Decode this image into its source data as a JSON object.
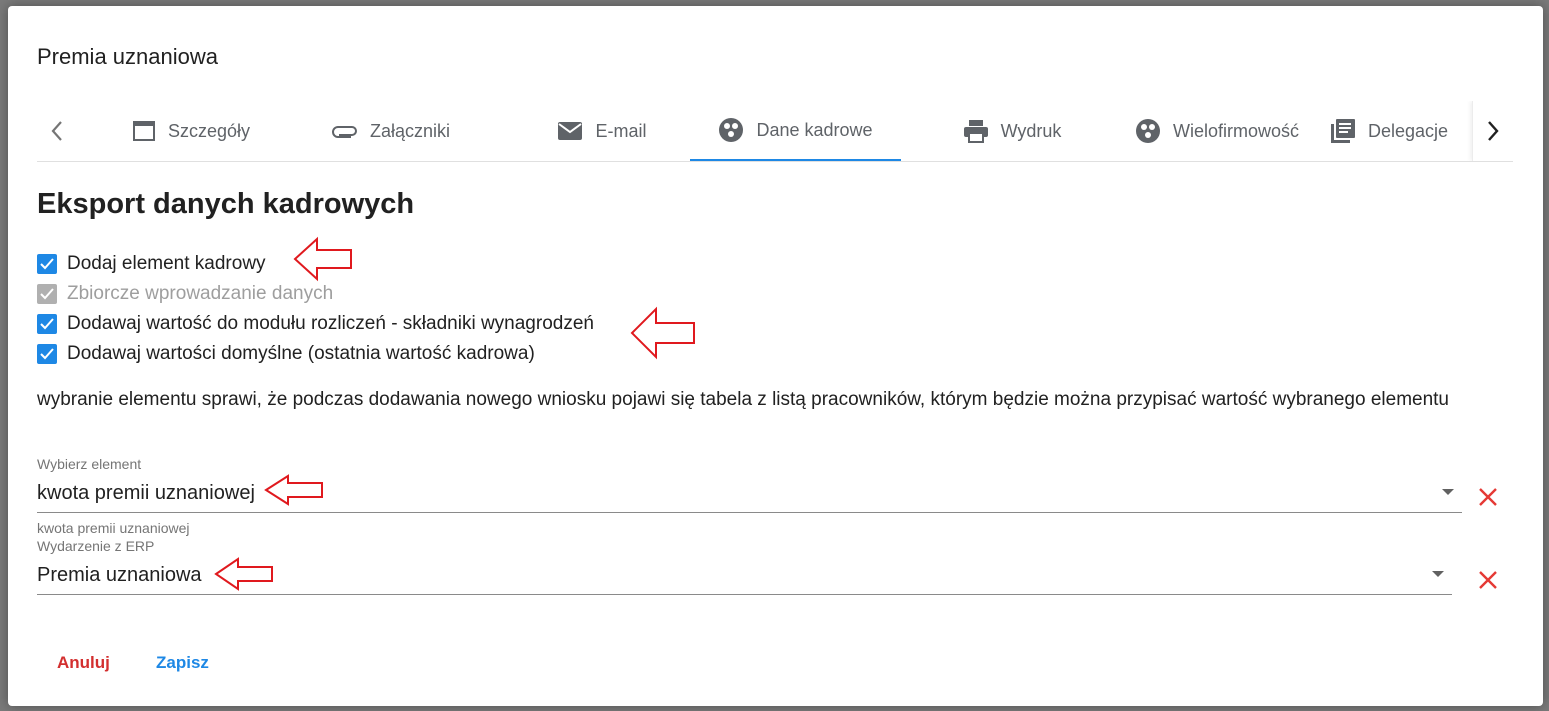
{
  "dialog": {
    "title": "Premia uznaniowa"
  },
  "tabs": [
    {
      "label": "Szczegóły",
      "icon": "window-icon"
    },
    {
      "label": "Załączniki",
      "icon": "paperclip-icon"
    },
    {
      "label": "E-mail",
      "icon": "mail-icon"
    },
    {
      "label": "Dane kadrowe",
      "icon": "group-icon",
      "active": true
    },
    {
      "label": "Wydruk",
      "icon": "printer-icon"
    },
    {
      "label": "Wielofirmowość",
      "icon": "group-icon"
    },
    {
      "label": "Delegacje",
      "icon": "library-icon"
    }
  ],
  "section": {
    "title": "Eksport danych kadrowych"
  },
  "checkboxes": [
    {
      "label": "Dodaj element kadrowy",
      "checked": true,
      "disabled": false
    },
    {
      "label": "Zbiorcze wprowadzanie danych",
      "checked": true,
      "disabled": true
    },
    {
      "label": "Dodawaj wartość do modułu rozliczeń - składniki wynagrodzeń",
      "checked": true,
      "disabled": false
    },
    {
      "label": "Dodawaj wartości domyślne (ostatnia wartość kadrowa)",
      "checked": true,
      "disabled": false
    }
  ],
  "description": "wybranie elementu sprawi, że podczas dodawania nowego wniosku pojawi się tabela z listą pracowników, którym będzie można przypisać wartość wybranego elementu",
  "fields": {
    "element": {
      "label": "Wybierz element",
      "value": "kwota premii uznaniowej",
      "hint": "kwota premii uznaniowej"
    },
    "erp": {
      "label": "Wydarzenie z ERP",
      "value": "Premia uznaniowa"
    }
  },
  "actions": {
    "cancel": "Anuluj",
    "save": "Zapisz"
  },
  "colors": {
    "accent": "#1e88e5",
    "danger": "#d32f2f",
    "annotation": "#e0191e"
  }
}
